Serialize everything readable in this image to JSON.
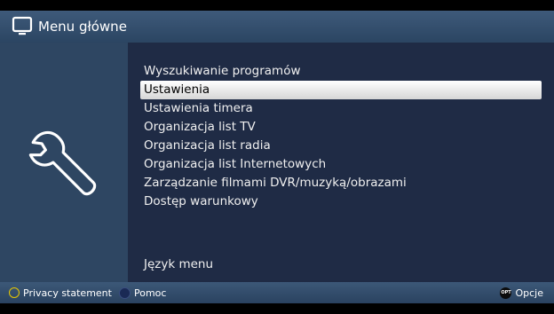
{
  "header": {
    "title": "Menu główne",
    "icon": "tv-icon"
  },
  "menu": {
    "items": [
      {
        "label": "Wyszukiwanie programów",
        "selected": false
      },
      {
        "label": "Ustawienia",
        "selected": true
      },
      {
        "label": "Ustawienia timera",
        "selected": false
      },
      {
        "label": "Organizacja list TV",
        "selected": false
      },
      {
        "label": "Organizacja list radia",
        "selected": false
      },
      {
        "label": "Organizacja list Internetowych",
        "selected": false
      },
      {
        "label": "Zarządzanie filmami DVR/muzyką/obrazami",
        "selected": false
      },
      {
        "label": "Dostęp warunkowy",
        "selected": false
      }
    ],
    "language_item": "Język menu"
  },
  "sidebar": {
    "icon": "wrench-icon"
  },
  "footer": {
    "yellow_label": "Privacy statement",
    "blue_label": "Pomoc",
    "opt_badge": "OPT",
    "opt_label": "Opcje"
  },
  "colors": {
    "selected_bg": "#ffffff",
    "header_bg": "#3e5a7a",
    "content_bg": "#1f2b45",
    "yellow_button": "#e8c800"
  }
}
